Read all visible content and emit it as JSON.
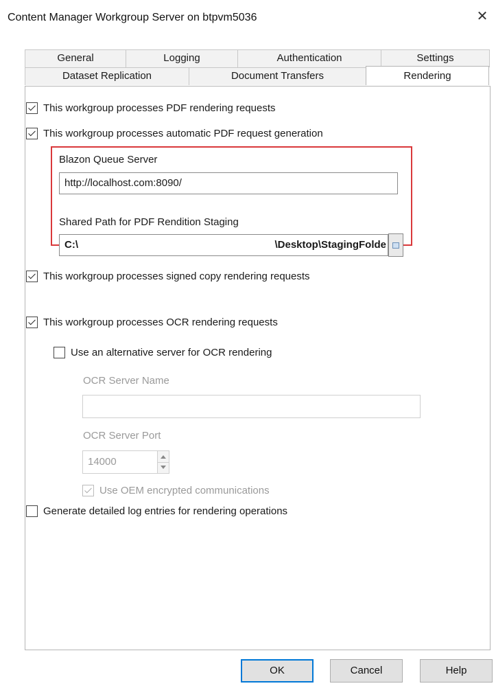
{
  "window": {
    "title": "Content Manager Workgroup Server on btpvm5036",
    "close_glyph": "✕"
  },
  "tabs_top": [
    {
      "label": "General"
    },
    {
      "label": "Logging"
    },
    {
      "label": "Authentication"
    },
    {
      "label": "Settings"
    }
  ],
  "tabs_bottom": [
    {
      "label": "Dataset Replication"
    },
    {
      "label": "Document Transfers"
    },
    {
      "label": "Rendering",
      "active": true
    }
  ],
  "rendering": {
    "pdf_rendering": {
      "label": "This workgroup processes PDF rendering requests",
      "checked": true
    },
    "auto_pdf": {
      "label": "This workgroup processes automatic PDF request generation",
      "checked": true
    },
    "blazon_label": "Blazon Queue Server",
    "blazon_value": "http://localhost.com:8090/",
    "shared_path_label": "Shared Path for PDF Rendition Staging",
    "shared_path_start": "C:\\",
    "shared_path_end": "\\Desktop\\StagingFolde",
    "signed_copy": {
      "label": "This workgroup processes signed copy rendering requests",
      "checked": true
    },
    "ocr": {
      "label": "This workgroup processes OCR rendering requests",
      "checked": true
    },
    "alt_server": {
      "label": "Use an alternative server for OCR rendering",
      "checked": false
    },
    "ocr_server_name_label": "OCR Server Name",
    "ocr_server_name_value": "",
    "ocr_server_port_label": "OCR Server Port",
    "ocr_server_port_value": "14000",
    "oem": {
      "label": "Use OEM encrypted communications",
      "checked": true,
      "disabled": true
    },
    "detailed_log": {
      "label": "Generate detailed log entries for rendering operations",
      "checked": false
    }
  },
  "buttons": {
    "ok": "OK",
    "cancel": "Cancel",
    "help": "Help"
  },
  "colors": {
    "highlight": "#d9383a",
    "primary_border": "#0078d7"
  }
}
